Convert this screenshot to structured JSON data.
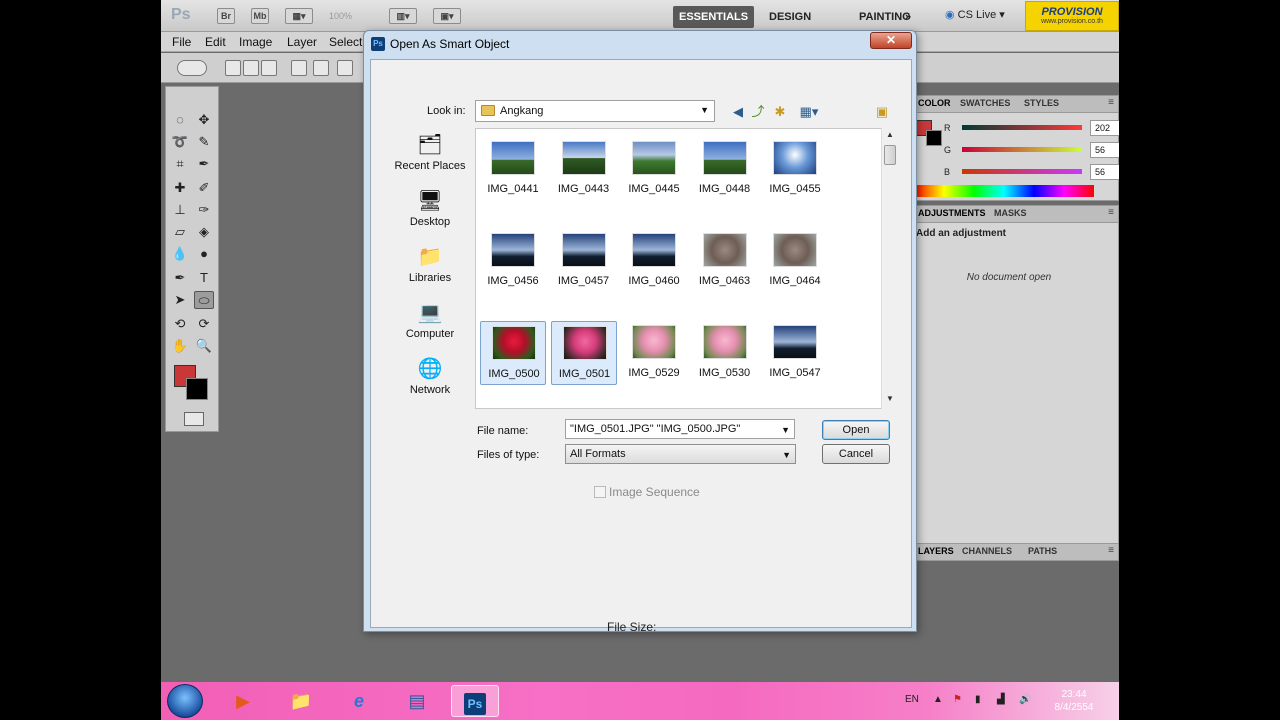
{
  "app": {
    "logo": "Ps",
    "bridge_label": "Br",
    "minibridge_label": "Mb",
    "zoom": "100%",
    "workspaces": [
      "ESSENTIALS",
      "DESIGN",
      "PAINTING"
    ],
    "more_workspaces": "»",
    "cs_live": "CS Live",
    "brand_name": "PROVISION",
    "brand_url": "www.provision.co.th"
  },
  "menu": [
    "File",
    "Edit",
    "Image",
    "Layer",
    "Select"
  ],
  "panels": {
    "color_tabs": [
      "COLOR",
      "SWATCHES",
      "STYLES"
    ],
    "color": {
      "r_label": "R",
      "g_label": "G",
      "b_label": "B",
      "r": "202",
      "g": "56",
      "b": "56",
      "fg": "#ca3838"
    },
    "adjust_tabs": [
      "ADJUSTMENTS",
      "MASKS"
    ],
    "adjust_title": "Add an adjustment",
    "no_document": "No document open",
    "layer_tabs": [
      "LAYERS",
      "CHANNELS",
      "PATHS"
    ]
  },
  "dialog": {
    "title": "Open As Smart Object",
    "close_label": "✕",
    "look_in_label": "Look in:",
    "look_in_value": "Angkang",
    "places": [
      {
        "label": "Recent Places",
        "icon": "recent-places-icon"
      },
      {
        "label": "Desktop",
        "icon": "desktop-icon"
      },
      {
        "label": "Libraries",
        "icon": "libraries-icon"
      },
      {
        "label": "Computer",
        "icon": "computer-icon"
      },
      {
        "label": "Network",
        "icon": "network-icon"
      }
    ],
    "files": [
      {
        "name": "IMG_0441",
        "thumb": "sky1",
        "selected": false
      },
      {
        "name": "IMG_0443",
        "thumb": "sky2",
        "selected": false
      },
      {
        "name": "IMG_0445",
        "thumb": "sky3",
        "selected": false
      },
      {
        "name": "IMG_0448",
        "thumb": "sky1",
        "selected": false
      },
      {
        "name": "IMG_0455",
        "thumb": "sky4",
        "selected": false
      },
      {
        "name": "IMG_0456",
        "thumb": "sky5",
        "selected": false
      },
      {
        "name": "IMG_0457",
        "thumb": "sky5",
        "selected": false
      },
      {
        "name": "IMG_0460",
        "thumb": "sky5",
        "selected": false
      },
      {
        "name": "IMG_0463",
        "thumb": "rock",
        "selected": false
      },
      {
        "name": "IMG_0464",
        "thumb": "rock",
        "selected": false
      },
      {
        "name": "IMG_0500",
        "thumb": "rose-red",
        "selected": true
      },
      {
        "name": "IMG_0501",
        "thumb": "rose-pink",
        "selected": true
      },
      {
        "name": "IMG_0529",
        "thumb": "rose-lt",
        "selected": false
      },
      {
        "name": "IMG_0530",
        "thumb": "rose-lt",
        "selected": false
      },
      {
        "name": "IMG_0547",
        "thumb": "sky5",
        "selected": false
      }
    ],
    "file_name_label": "File name:",
    "file_name_value": "\"IMG_0501.JPG\" \"IMG_0500.JPG\"",
    "file_type_label": "Files of type:",
    "file_type_value": "All Formats",
    "open_label": "Open",
    "cancel_label": "Cancel",
    "image_sequence_label": "Image Sequence",
    "file_size_label": "File Size:"
  },
  "taskbar": {
    "apps": [
      "media-player-icon",
      "explorer-icon",
      "ie-icon",
      "network-center-icon",
      "photoshop-icon"
    ],
    "ps_label": "Ps",
    "lang": "EN",
    "time": "23:44",
    "date": "8/4/2554"
  }
}
